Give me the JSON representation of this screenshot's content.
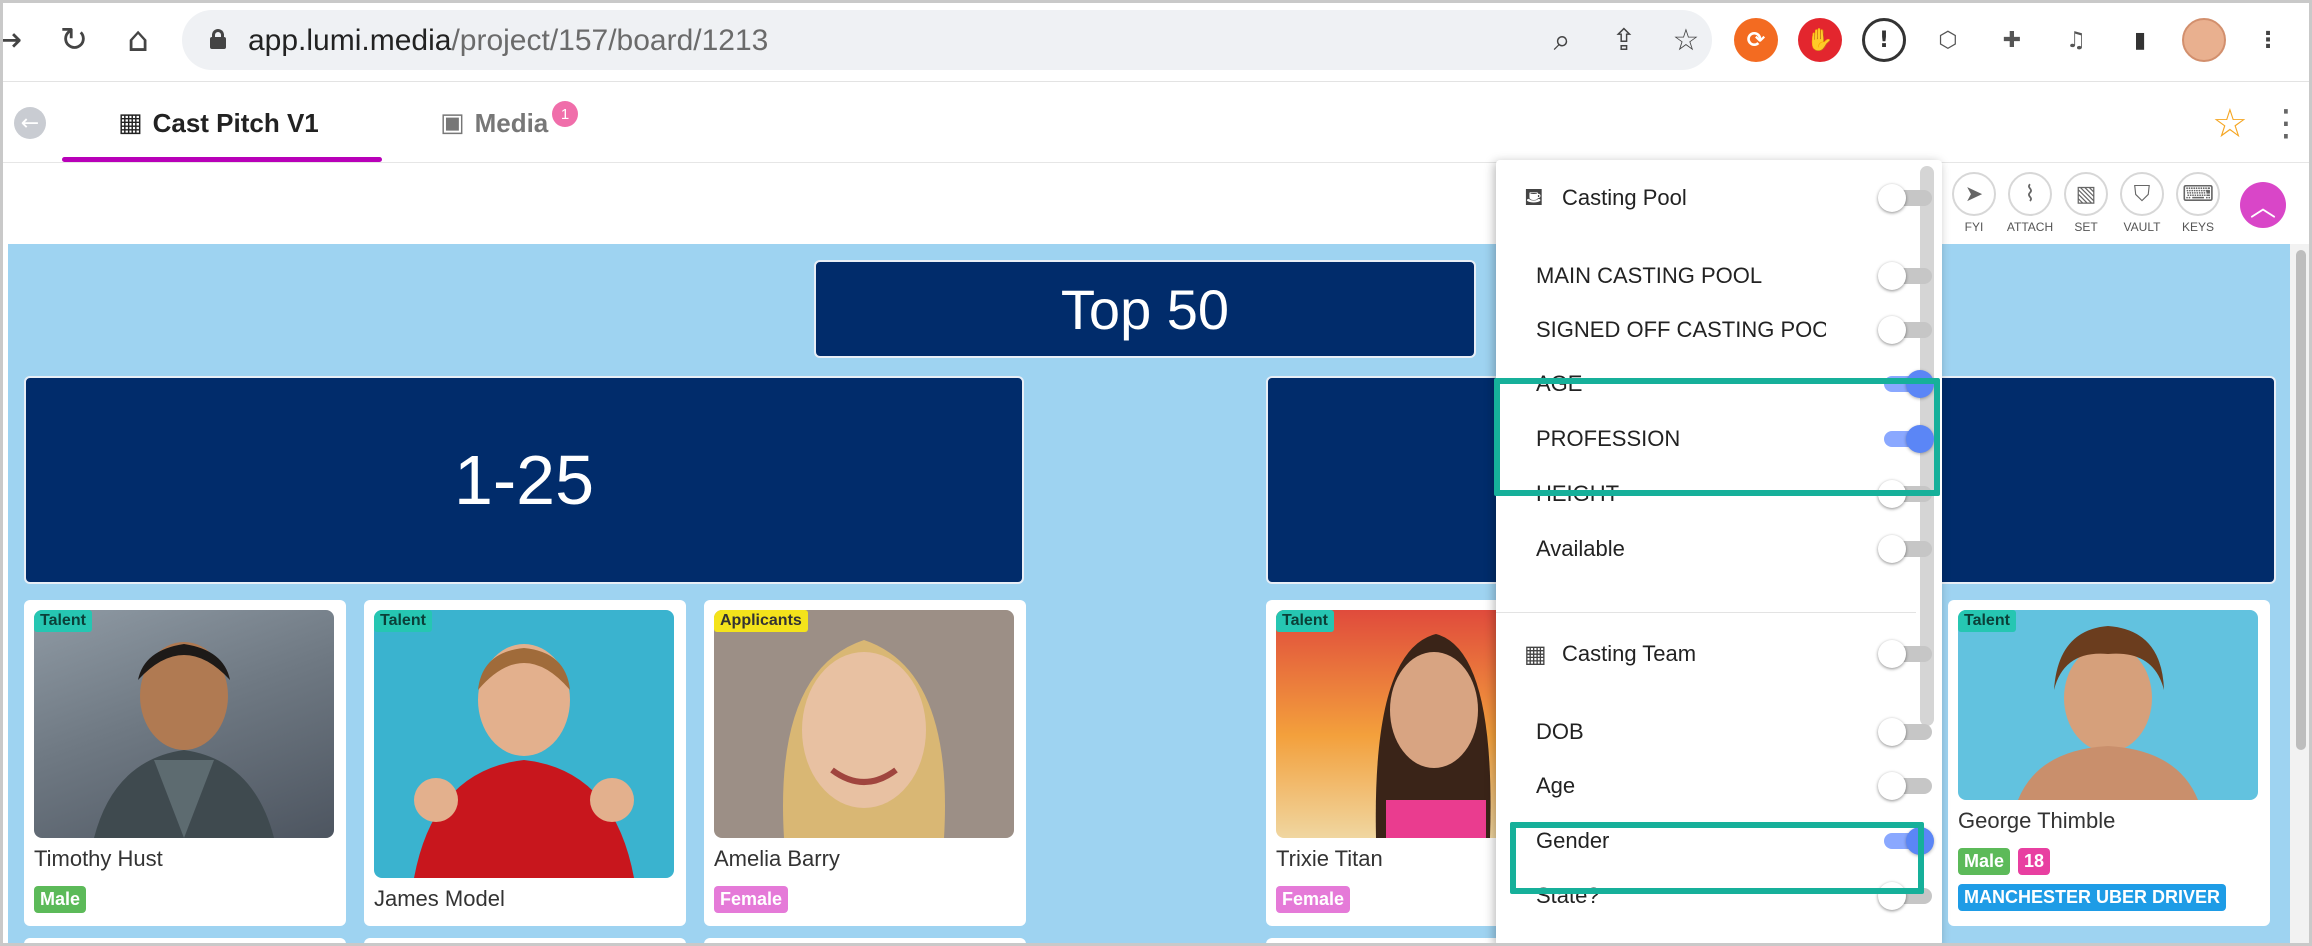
{
  "browser": {
    "url_host": "app.lumi.media",
    "url_path": "/project/157/board/1213"
  },
  "tabs": {
    "active": "Cast Pitch V1",
    "media": "Media",
    "media_badge": "1"
  },
  "toolbar": {
    "fyi": "FYI",
    "attach": "ATTACH",
    "set": "SET",
    "vault": "VAULT",
    "keys": "KEYS"
  },
  "board": {
    "title": "Top 50",
    "group1": "1-25"
  },
  "cards": [
    {
      "tag": "Talent",
      "name": "Timothy Hust",
      "gender": "Male"
    },
    {
      "tag": "Talent",
      "name": "James Model"
    },
    {
      "tag": "Applicants",
      "name": "Amelia Barry",
      "gender": "Female"
    },
    {
      "tag": "Talent",
      "name": "Trixie Titan",
      "gender": "Female"
    },
    {
      "tag": "Talent",
      "name": "George Thimble",
      "gender": "Male",
      "age": "18",
      "profession": "MANCHESTER UBER DRIVER"
    }
  ],
  "panel": {
    "casting_pool": {
      "heading": "Casting Pool",
      "items": [
        "MAIN CASTING POOL",
        "SIGNED OFF CASTING POOL",
        "AGE",
        "PROFESSION",
        "HEIGHT",
        "Available"
      ]
    },
    "casting_team": {
      "heading": "Casting Team",
      "items": [
        "DOB",
        "Age",
        "Gender",
        "State?"
      ]
    }
  },
  "colors": {
    "board_bg": "#9ed3f1",
    "banner": "#012c6b",
    "tab_accent": "#b800b8",
    "highlight": "#16b09a",
    "toggle_on": "#5b86f6"
  }
}
